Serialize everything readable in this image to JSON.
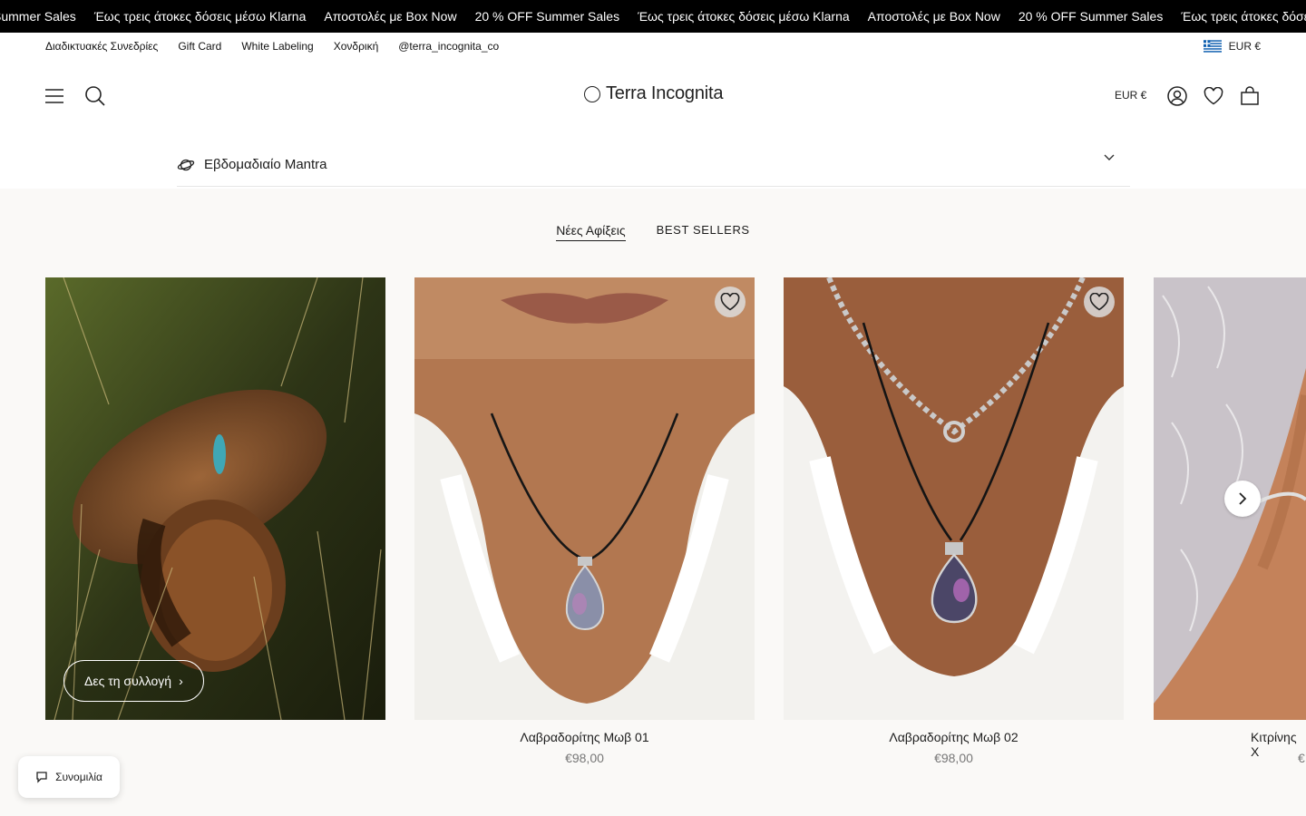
{
  "announcements": [
    "Summer Sales",
    "Έως τρεις άτοκες δόσεις μέσω Klarna",
    "Αποστολές με Box Now",
    "20 % OFF Summer Sales",
    "Έως τρεις άτοκες δόσεις μέσω Klarna",
    "Αποστολές με Box Now",
    "20 % OFF Summer Sales",
    "Έως τρεις άτοκες δόσεις"
  ],
  "topnav": {
    "links": [
      "Διαδικτυακές Συνεδρίες",
      "Gift Card",
      "White Labeling",
      "Χονδρική",
      "@terra_incognita_co"
    ],
    "locale": "EUR €"
  },
  "header": {
    "logo": "Terra Incognita",
    "currency": "EUR €"
  },
  "mantra": {
    "label": "Εβδομαδιαίο Mantra"
  },
  "tabs": [
    {
      "label": "Νέες Αφίξεις",
      "active": true
    },
    {
      "label": "BEST SELLERS",
      "active": false
    }
  ],
  "collection": {
    "cta": "Δες τη συλλογή"
  },
  "products": [
    {
      "name": "Λαβραδορίτης Μωβ 01",
      "price": "€98,00"
    },
    {
      "name": "Λαβραδορίτης Μωβ 02",
      "price": "€98,00"
    },
    {
      "name": "Κιτρίνης Χ",
      "price": "€"
    }
  ],
  "chat": {
    "label": "Συνομιλία"
  },
  "colors": {
    "accent": "#000000",
    "background": "#faf9f7"
  }
}
